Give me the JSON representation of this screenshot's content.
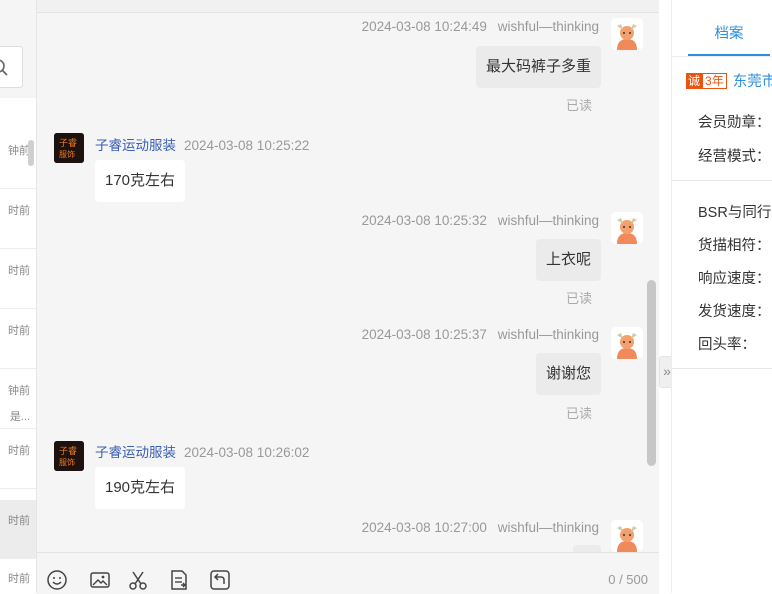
{
  "conversation_list": {
    "items": [
      {
        "time": "钟前",
        "extra": ""
      },
      {
        "time": "时前",
        "extra": ""
      },
      {
        "time": "时前",
        "extra": ""
      },
      {
        "time": "时前",
        "extra": ""
      },
      {
        "time": "钟前",
        "extra": "是..."
      },
      {
        "time": "时前",
        "extra": ""
      },
      {
        "time": "时前",
        "extra": ""
      },
      {
        "time": "时前",
        "extra": ""
      }
    ]
  },
  "chat": {
    "messages": [
      {
        "time": "2024-03-08 10:24:49",
        "sender": "wishful—thinking",
        "text": "最大码裤子多重",
        "status": "已读"
      },
      {
        "time": "2024-03-08 10:25:22",
        "sender": "子睿运动服装",
        "text": "170克左右"
      },
      {
        "time": "2024-03-08 10:25:32",
        "sender": "wishful—thinking",
        "text": "上衣呢",
        "status": "已读"
      },
      {
        "time": "2024-03-08 10:25:37",
        "sender": "wishful—thinking",
        "text": "谢谢您",
        "status": "已读"
      },
      {
        "time": "2024-03-08 10:26:02",
        "sender": "子睿运动服装",
        "text": "190克左右"
      },
      {
        "time": "2024-03-08 10:27:00",
        "sender": "wishful—thinking",
        "text": ""
      }
    ]
  },
  "input": {
    "counter": "0 / 500"
  },
  "collapse": {
    "glyph": "»"
  },
  "profile_panel": {
    "tab_label": "档案",
    "badge_cheng": "诚",
    "badge_years": "3年",
    "city": "东莞市",
    "fields": [
      "会员勋章：",
      "经营模式：",
      "BSR与同行均",
      "货描相符：",
      "响应速度：",
      "发货速度：",
      "回头率："
    ]
  },
  "colors": {
    "accent_blue": "#2d8fde",
    "shop_name": "#3b5fb8",
    "badge_orange": "#e95511",
    "chat_bg": "#f5f5f5"
  }
}
